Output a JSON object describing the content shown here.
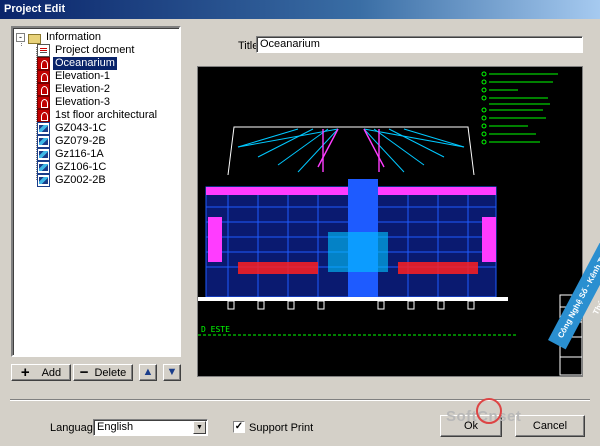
{
  "window": {
    "title": "Project Edit"
  },
  "tree": {
    "root": {
      "label": "Information",
      "expander": "-"
    },
    "items": [
      {
        "label": "Project docment",
        "icon": "document-icon"
      },
      {
        "label": "Oceanarium",
        "icon": "red-drawing-icon",
        "selected": true
      },
      {
        "label": "Elevation-1",
        "icon": "red-drawing-icon"
      },
      {
        "label": "Elevation-2",
        "icon": "red-drawing-icon"
      },
      {
        "label": "Elevation-3",
        "icon": "red-drawing-icon"
      },
      {
        "label": "1st floor architectural",
        "icon": "red-drawing-icon"
      },
      {
        "label": "GZ043-1C",
        "icon": "blue-drawing-icon"
      },
      {
        "label": "GZ079-2B",
        "icon": "blue-drawing-icon"
      },
      {
        "label": "Gz116-1A",
        "icon": "blue-drawing-icon"
      },
      {
        "label": "GZ106-1C",
        "icon": "blue-drawing-icon"
      },
      {
        "label": "GZ002-2B",
        "icon": "blue-drawing-icon"
      }
    ]
  },
  "toolbar": {
    "add_label": "Add",
    "delete_label": "Delete",
    "add_glyph": "+",
    "delete_glyph": "−",
    "up_glyph": "▲",
    "down_glyph": "▼"
  },
  "form": {
    "title_label": "Title",
    "title_value": "Oceanarium"
  },
  "drawing_text": {
    "corner_label": "D ESTE"
  },
  "footer": {
    "language_label": "Language",
    "language_value": "English",
    "support_print_label": "Support Print",
    "support_print_checked": "✓",
    "ok_label": "Ok",
    "cancel_label": "Cancel"
  },
  "watermark": {
    "text": "SoftCnset",
    "ribbon": "Công Nghệ Số - Kênh Trí Thức"
  },
  "colors": {
    "cad_background": "#000000",
    "cad_blue": "#1e5bff",
    "cad_cyan": "#00c8ff",
    "cad_magenta": "#ff3cff",
    "cad_green": "#00ff00",
    "cad_red": "#ff2020",
    "selection": "#0a246a"
  }
}
